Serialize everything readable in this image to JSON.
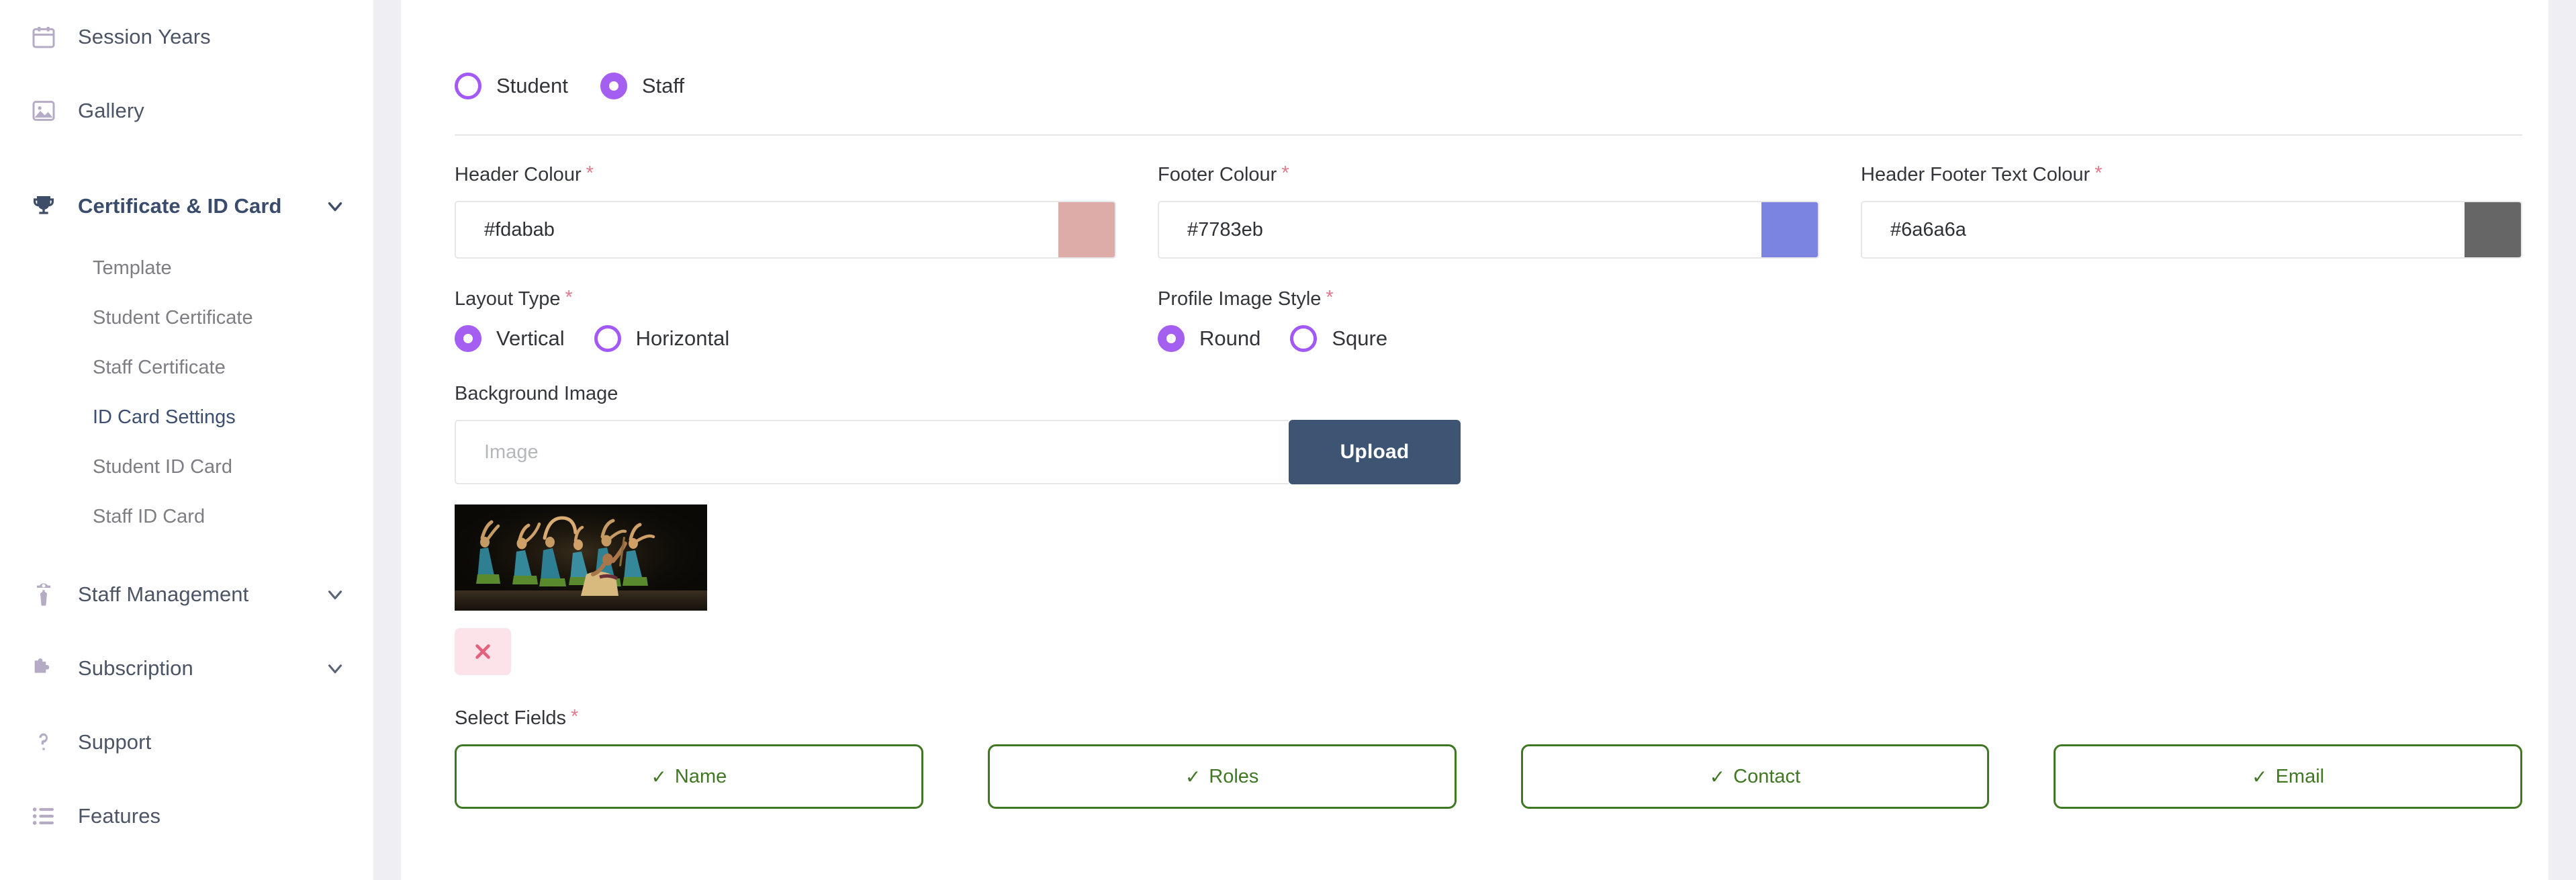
{
  "sidebar": {
    "items": [
      {
        "label": "Session Years",
        "icon": "calendar-icon",
        "type": "link"
      },
      {
        "label": "Gallery",
        "icon": "image-icon",
        "type": "link"
      },
      {
        "label": "Certificate & ID Card",
        "icon": "trophy-icon",
        "type": "group",
        "expanded": true,
        "active": true
      },
      {
        "label": "Staff Management",
        "icon": "user-tie-icon",
        "type": "group",
        "expanded": false
      },
      {
        "label": "Subscription",
        "icon": "puzzle-icon",
        "type": "group",
        "expanded": false
      },
      {
        "label": "Support",
        "icon": "question-icon",
        "type": "link"
      },
      {
        "label": "Features",
        "icon": "list-icon",
        "type": "link"
      }
    ],
    "sub_items": [
      {
        "label": "Template",
        "active": false
      },
      {
        "label": "Student Certificate",
        "active": false
      },
      {
        "label": "Staff Certificate",
        "active": false
      },
      {
        "label": "ID Card Settings",
        "active": true
      },
      {
        "label": "Student ID Card",
        "active": false
      },
      {
        "label": "Staff ID Card",
        "active": false
      }
    ]
  },
  "main": {
    "user_type": {
      "options": [
        {
          "label": "Student",
          "selected": false
        },
        {
          "label": "Staff",
          "selected": true
        }
      ]
    },
    "colour_fields": [
      {
        "label": "Header Colour",
        "required": "*",
        "value": "#fdabab",
        "swatch": "#ddaca8"
      },
      {
        "label": "Footer Colour",
        "required": "*",
        "value": "#7783eb",
        "swatch": "#7c84e2"
      },
      {
        "label": "Header Footer Text Colour",
        "required": "*",
        "value": "#6a6a6a",
        "swatch": "#666666"
      }
    ],
    "layout_type": {
      "label": "Layout Type",
      "required": "*",
      "options": [
        {
          "label": "Vertical",
          "selected": true
        },
        {
          "label": "Horizontal",
          "selected": false
        }
      ]
    },
    "profile_image_style": {
      "label": "Profile Image Style",
      "required": "*",
      "options": [
        {
          "label": "Round",
          "selected": true
        },
        {
          "label": "Squre",
          "selected": false
        }
      ]
    },
    "background_image": {
      "label": "Background Image",
      "input_value": "",
      "placeholder": "Image",
      "upload_label": "Upload",
      "thumbnail_alt": "dance-performance-photo",
      "delete_icon": "close-x-icon"
    },
    "select_fields": {
      "label": "Select Fields",
      "required": "*",
      "chips": [
        {
          "label": "Name",
          "tick": "✓",
          "selected": true
        },
        {
          "label": "Roles",
          "tick": "✓",
          "selected": true
        },
        {
          "label": "Contact",
          "tick": "✓",
          "selected": true
        },
        {
          "label": "Email",
          "tick": "✓",
          "selected": true
        }
      ]
    }
  },
  "colors": {
    "accent_purple": "#a45ef0",
    "sidebar_icon": "#b6abc4",
    "sidebar_text": "#4c5566",
    "active_sub": "#3c4f72",
    "required_star": "#e3798c",
    "upload_btn": "#3d5573",
    "chip_green": "#3f7722",
    "delete_bg": "#fbe3e9",
    "delete_x": "#e4617b"
  }
}
